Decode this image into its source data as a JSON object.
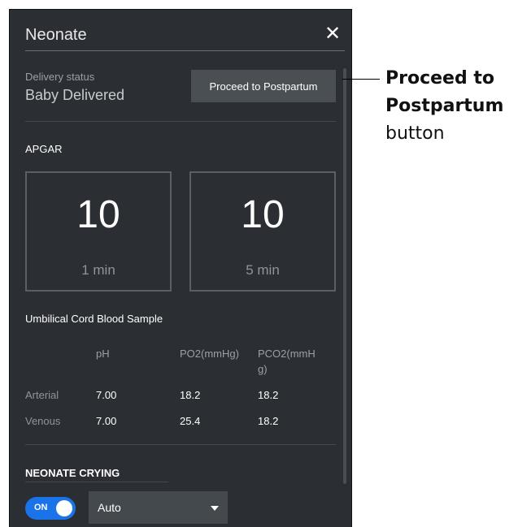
{
  "panel": {
    "title": "Neonate",
    "close_icon": "close-icon"
  },
  "delivery": {
    "label": "Delivery status",
    "value": "Baby Delivered",
    "button_label": "Proceed to Postpartum"
  },
  "apgar": {
    "heading": "APGAR",
    "scores": [
      {
        "score": "10",
        "label": "1 min"
      },
      {
        "score": "10",
        "label": "5 min"
      }
    ]
  },
  "cord_blood": {
    "heading": "Umbilical Cord Blood Sample",
    "columns": [
      "pH",
      "PO2(mmHg)",
      "PCO2(mmH",
      "g)"
    ],
    "rows": [
      {
        "label": "Arterial",
        "ph": "7.00",
        "po2": "18.2",
        "pco2": "18.2"
      },
      {
        "label": "Venous",
        "ph": "7.00",
        "po2": "25.4",
        "pco2": "18.2"
      }
    ]
  },
  "crying": {
    "heading": "NEONATE CRYING",
    "toggle_label": "ON",
    "toggle_on": true,
    "mode_value": "Auto"
  },
  "callout": {
    "line1": "Proceed to",
    "line2": "Postpartum",
    "line3": "button"
  },
  "colors": {
    "panel_bg": "#2b2f33",
    "toggle_accent": "#1a73e8",
    "button_bg": "#4a4f54"
  }
}
